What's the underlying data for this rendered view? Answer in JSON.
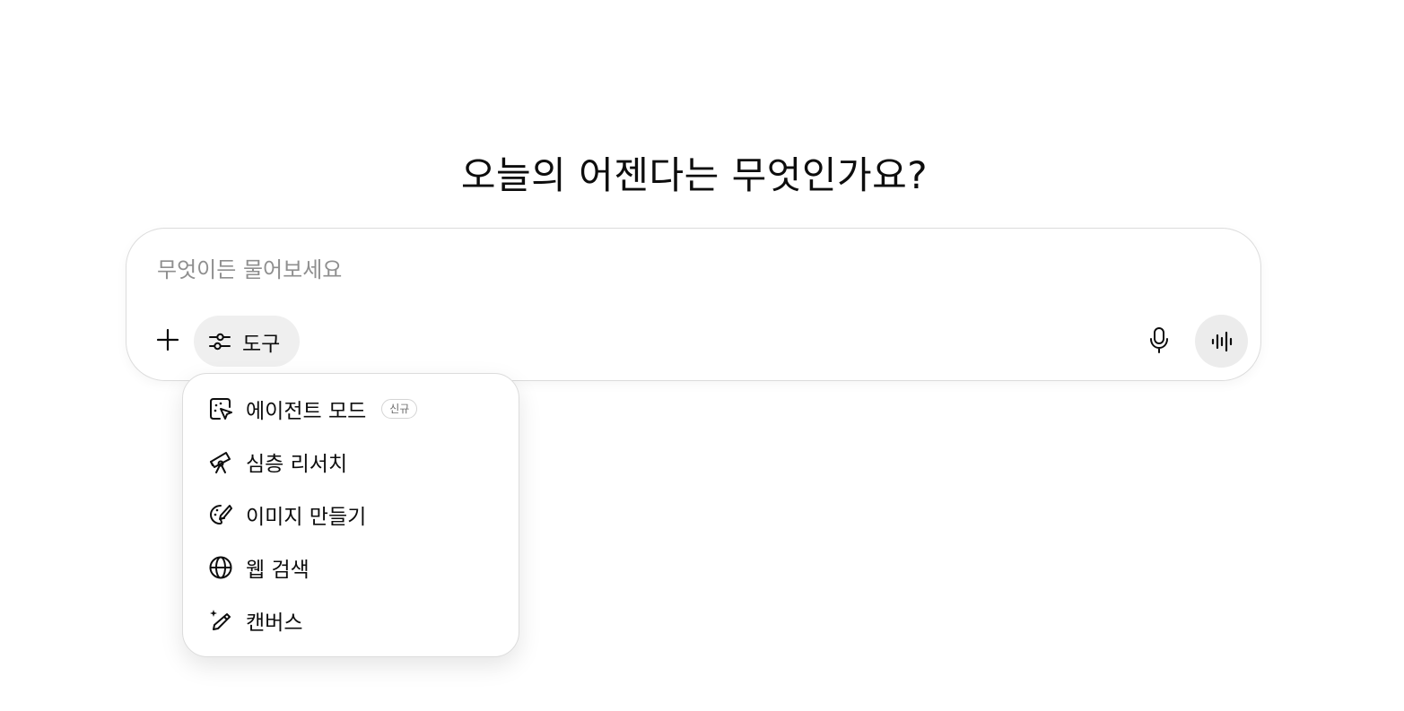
{
  "headline": "오늘의 어젠다는 무엇인가요?",
  "composer": {
    "placeholder": "무엇이든 물어보세요",
    "value": "",
    "tools_label": "도구",
    "plus_icon": "plus-icon",
    "tools_icon": "sliders-icon",
    "mic_icon": "microphone-icon",
    "voice_icon": "voice-waveform-icon"
  },
  "tools_menu": {
    "items": [
      {
        "label": "에이전트 모드",
        "icon": "agent-cursor-icon",
        "badge": "신규"
      },
      {
        "label": "심층 리서치",
        "icon": "telescope-icon"
      },
      {
        "label": "이미지 만들기",
        "icon": "palette-brush-icon"
      },
      {
        "label": "웹 검색",
        "icon": "globe-icon"
      },
      {
        "label": "캔버스",
        "icon": "pencil-sparkle-icon"
      }
    ]
  }
}
